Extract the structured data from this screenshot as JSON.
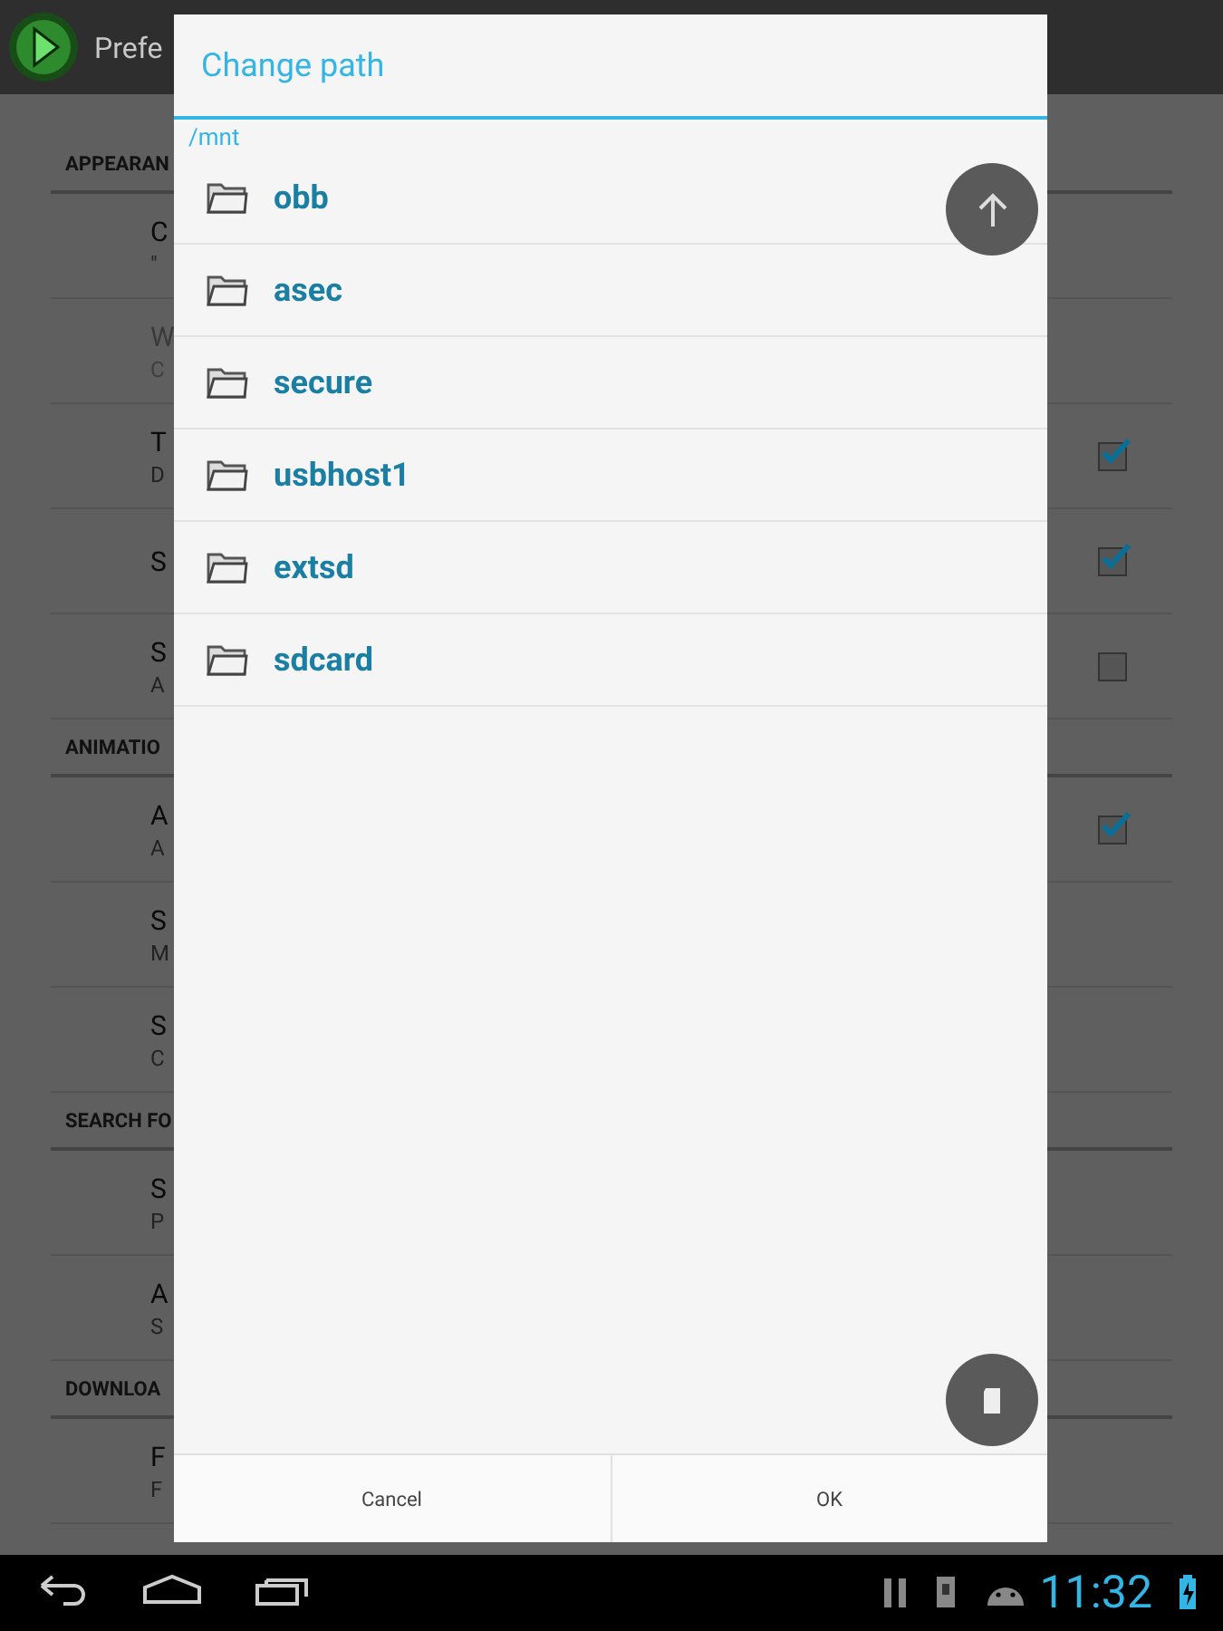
{
  "action_bar": {
    "title": "Prefe"
  },
  "settings": [
    {
      "header": "APPEARAN",
      "items": [
        {
          "kind": "plain",
          "title": "C",
          "summary": "\"",
          "disabled": false
        },
        {
          "kind": "plain",
          "title": "W",
          "summary": "C",
          "disabled": true
        },
        {
          "kind": "toggle",
          "title": "T",
          "summary": "D",
          "disabled": false,
          "checked": true
        },
        {
          "kind": "toggle",
          "title": "S",
          "disabled": false,
          "checked": true
        },
        {
          "kind": "toggle",
          "title": "S",
          "summary": "A",
          "disabled": false,
          "checked": false
        }
      ]
    },
    {
      "header": "ANIMATIO",
      "items": [
        {
          "kind": "toggle",
          "title": "A",
          "summary": "A",
          "disabled": false,
          "checked": true
        },
        {
          "kind": "plain",
          "title": "S",
          "summary": "M",
          "disabled": false
        },
        {
          "kind": "plain",
          "title": "S",
          "summary": "C",
          "disabled": false
        }
      ]
    },
    {
      "header": "SEARCH FO",
      "items": [
        {
          "kind": "plain",
          "title": "S",
          "summary": "P",
          "disabled": false
        },
        {
          "kind": "plain",
          "title": "A",
          "summary": "S",
          "disabled": false
        }
      ]
    },
    {
      "header": "DOWNLOA",
      "items": [
        {
          "kind": "plain",
          "title": "F",
          "summary": "F",
          "disabled": false
        }
      ]
    }
  ],
  "dialog": {
    "title": "Change path",
    "path": "/mnt",
    "folders": [
      "obb",
      "asec",
      "secure",
      "usbhost1",
      "extsd",
      "sdcard"
    ],
    "buttons": [
      "Cancel",
      "OK"
    ]
  },
  "status_bar": {
    "time": "11:32"
  }
}
